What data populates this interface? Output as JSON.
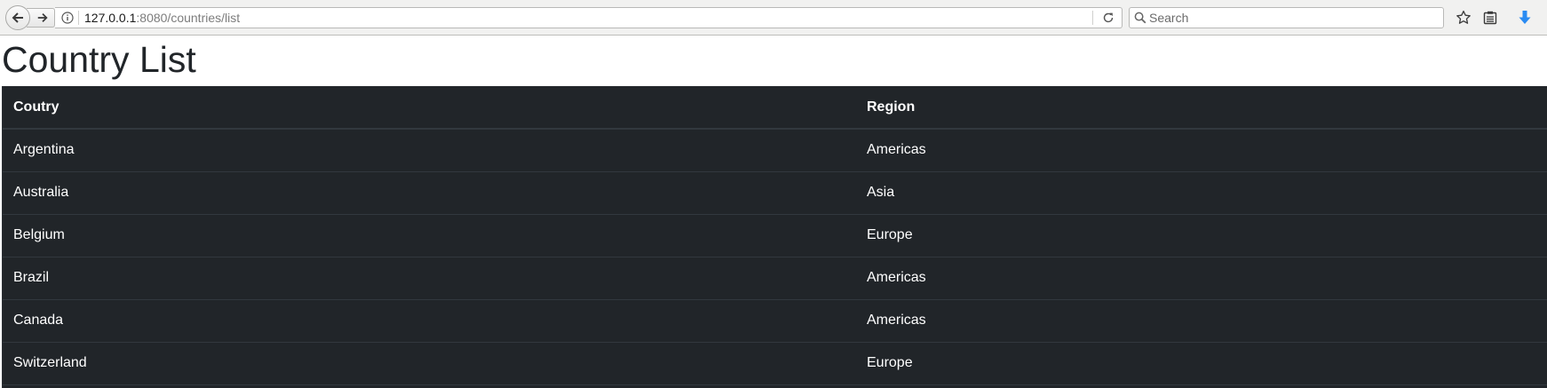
{
  "browser": {
    "url_host": "127.0.0.1",
    "url_rest": ":8080/countries/list",
    "search_placeholder": "Search",
    "icons": {
      "back": "arrow-left-icon",
      "forward": "arrow-right-icon",
      "info": "info-icon",
      "reload": "reload-icon",
      "search": "magnifier-icon",
      "bookmark": "star-icon",
      "library": "clipboard-icon",
      "downloads": "download-arrow-icon"
    },
    "colors": {
      "download_accent": "#2a8bf2"
    }
  },
  "page": {
    "title": "Country List",
    "table": {
      "header_bg": "#212529",
      "columns": [
        "Coutry",
        "Region"
      ],
      "rows": [
        {
          "country": "Argentina",
          "region": "Americas"
        },
        {
          "country": "Australia",
          "region": "Asia"
        },
        {
          "country": "Belgium",
          "region": "Europe"
        },
        {
          "country": "Brazil",
          "region": "Americas"
        },
        {
          "country": "Canada",
          "region": "Americas"
        },
        {
          "country": "Switzerland",
          "region": "Europe"
        }
      ]
    }
  }
}
